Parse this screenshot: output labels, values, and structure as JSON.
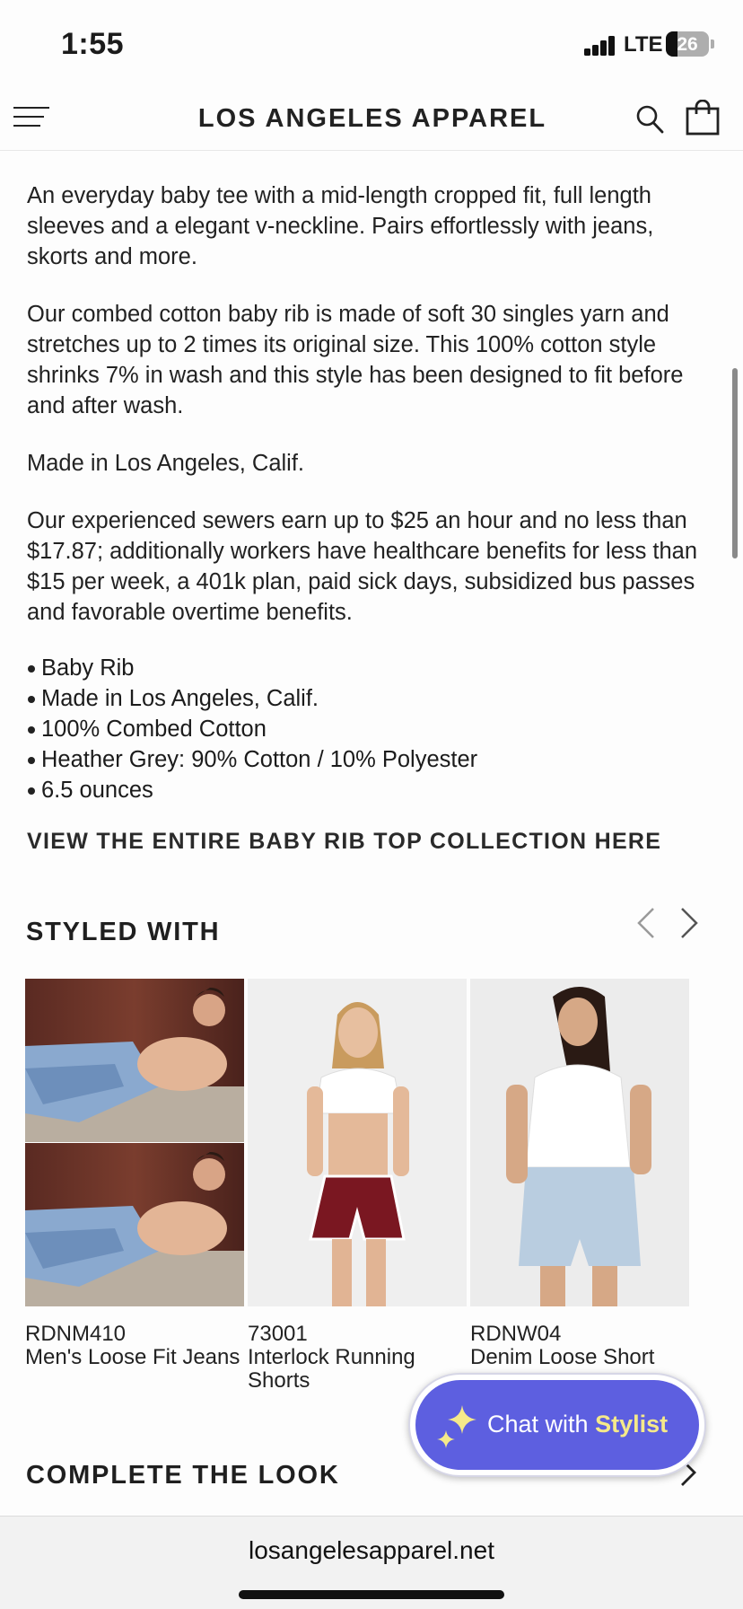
{
  "status_bar": {
    "time": "1:55",
    "network": "LTE",
    "battery": "26"
  },
  "header": {
    "brand": "LOS ANGELES APPAREL"
  },
  "description": {
    "paragraphs": [
      "An everyday baby tee with a mid-length cropped fit, full length sleeves and a elegant v-neckline. Pairs effortlessly with jeans, skorts and more.",
      "Our combed cotton baby rib is made of soft 30 singles yarn and stretches up to 2 times its original size. This 100% cotton style shrinks 7% in wash and this style has been designed to fit before and after wash.",
      "Made in Los Angeles, Calif.",
      "Our experienced sewers earn up to $25 an hour and no less than $17.87; additionally workers have healthcare benefits for less than $15 per week, a 401k plan, paid sick days, subsidized bus passes and favorable overtime benefits."
    ],
    "features": [
      "Baby Rib",
      "Made in Los Angeles, Calif.",
      "100% Combed Cotton",
      "Heather Grey: 90% Cotton / 10% Polyester",
      "6.5 ounces"
    ]
  },
  "collection_link": "VIEW THE ENTIRE BABY RIB TOP COLLECTION HERE",
  "styled_with": {
    "title": "STYLED WITH",
    "products": [
      {
        "code": "RDNM410",
        "name": "Men's Loose Fit Jeans"
      },
      {
        "code": "73001",
        "name": "Interlock Running Shorts"
      },
      {
        "code": "RDNW04",
        "name": "Denim Loose Short"
      }
    ]
  },
  "complete_the_look": {
    "title": "COMPLETE THE LOOK"
  },
  "chat": {
    "prefix": "Chat with ",
    "emphasis": "Stylist"
  },
  "browser": {
    "url": "losangelesapparel.net"
  },
  "colors": {
    "chat_button": "#5d5fe0",
    "chat_accent": "#f5e98a",
    "text": "#222222"
  }
}
